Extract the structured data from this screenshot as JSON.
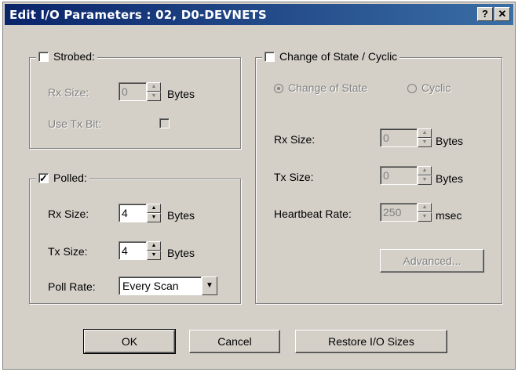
{
  "window": {
    "title": "Edit I/O Parameters : 02, D0-DEVNETS",
    "help_button": "?",
    "close_button": "✕"
  },
  "strobed": {
    "label": "Strobed:",
    "checked": false,
    "rx_size_label": "Rx Size:",
    "rx_size_value": "0",
    "rx_unit": "Bytes",
    "use_tx_bit_label": "Use Tx Bit:"
  },
  "polled": {
    "label": "Polled:",
    "checked": true,
    "check_mark": "✓",
    "rx_size_label": "Rx Size:",
    "rx_size_value": "4",
    "rx_unit": "Bytes",
    "tx_size_label": "Tx Size:",
    "tx_size_value": "4",
    "tx_unit": "Bytes",
    "poll_rate_label": "Poll Rate:",
    "poll_rate_value": "Every Scan"
  },
  "cos": {
    "label": "Change of State / Cyclic",
    "checked": false,
    "radio_cos": "Change of State",
    "radio_cyclic": "Cyclic",
    "rx_size_label": "Rx Size:",
    "rx_size_value": "0",
    "rx_unit": "Bytes",
    "tx_size_label": "Tx Size:",
    "tx_size_value": "0",
    "tx_unit": "Bytes",
    "heartbeat_label": "Heartbeat Rate:",
    "heartbeat_value": "250",
    "heartbeat_unit": "msec",
    "advanced_label": "Advanced..."
  },
  "buttons": {
    "ok": "OK",
    "cancel": "Cancel",
    "restore": "Restore I/O Sizes"
  },
  "colors": {
    "title_bar": "#0a246a",
    "dialog_face": "#d4d0c8"
  }
}
